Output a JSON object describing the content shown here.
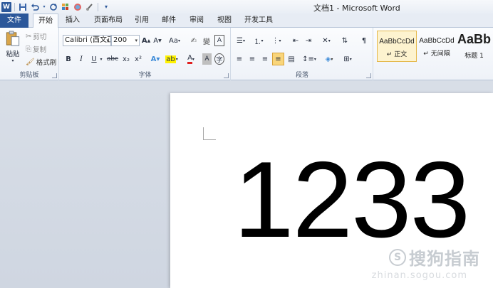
{
  "window": {
    "title": "文档1 - Microsoft Word"
  },
  "qat": {
    "items": [
      "word-logo",
      "save-icon",
      "undo-icon",
      "redo-icon",
      "format-painter-icon",
      "color-icon",
      "brush-icon",
      "customize-icon"
    ]
  },
  "tabs": [
    "文件",
    "开始",
    "插入",
    "页面布局",
    "引用",
    "邮件",
    "审阅",
    "视图",
    "开发工具"
  ],
  "active_tab": "开始",
  "clipboard": {
    "paste_label": "粘贴",
    "cut_label": "剪切",
    "copy_label": "复制",
    "format_painter_label": "格式刷",
    "group_label": "剪贴板"
  },
  "font": {
    "font_name": "Calibri (西文正文)",
    "font_size": "200",
    "grow_label": "A",
    "shrink_label": "A",
    "case_label": "Aa",
    "bold": "B",
    "italic": "I",
    "underline": "U",
    "strike": "abc",
    "subscript": "x₂",
    "superscript": "x²",
    "group_label": "字体"
  },
  "paragraph": {
    "group_label": "段落"
  },
  "styles": {
    "items": [
      {
        "sample": "AaBbCcDd",
        "name": "↵ 正文"
      },
      {
        "sample": "AaBbCcDd",
        "name": "↵ 无间隔"
      },
      {
        "sample": "AaBb",
        "name": "标题 1"
      }
    ]
  },
  "document": {
    "text": "1233"
  },
  "watermark": {
    "text": "搜狗指南",
    "sub": "zhinan.sogou.com"
  },
  "colors": {
    "file_tab": "#2b579a",
    "ribbon_bg": "#fbfcfe",
    "selected_style": "#fdf3cf",
    "workspace": "#d8dee7"
  }
}
